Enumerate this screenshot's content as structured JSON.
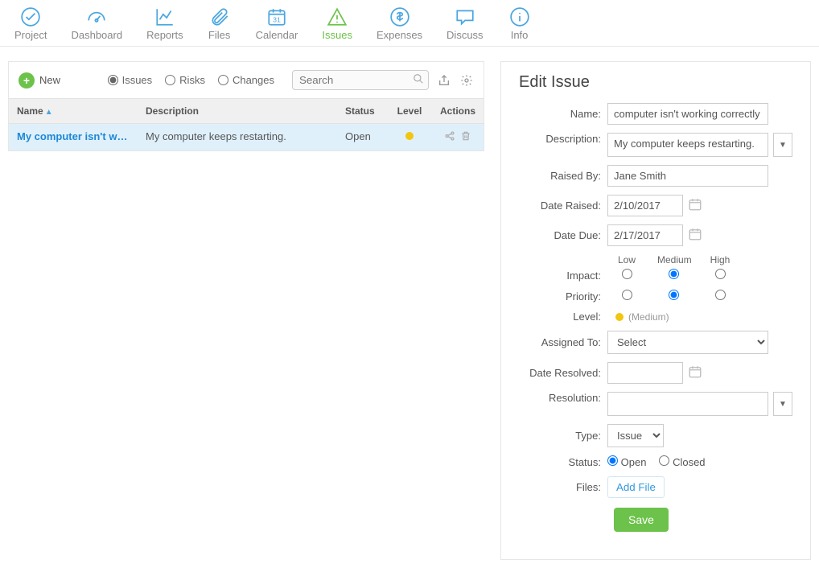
{
  "nav": {
    "items": [
      {
        "label": "Project"
      },
      {
        "label": "Dashboard"
      },
      {
        "label": "Reports"
      },
      {
        "label": "Files"
      },
      {
        "label": "Calendar"
      },
      {
        "label": "Issues"
      },
      {
        "label": "Expenses"
      },
      {
        "label": "Discuss"
      },
      {
        "label": "Info"
      }
    ]
  },
  "toolbar": {
    "new_label": "New",
    "filter_issues": "Issues",
    "filter_risks": "Risks",
    "filter_changes": "Changes",
    "search_placeholder": "Search"
  },
  "grid": {
    "headers": {
      "name": "Name",
      "description": "Description",
      "status": "Status",
      "level": "Level",
      "actions": "Actions"
    },
    "row": {
      "name": "My computer isn't wor...",
      "description": "My computer keeps restarting.",
      "status": "Open",
      "level_color": "#f2c60f"
    }
  },
  "form": {
    "title": "Edit Issue",
    "labels": {
      "name": "Name:",
      "description": "Description:",
      "raised_by": "Raised By:",
      "date_raised": "Date Raised:",
      "date_due": "Date Due:",
      "impact": "Impact:",
      "priority": "Priority:",
      "level": "Level:",
      "assigned_to": "Assigned To:",
      "date_resolved": "Date Resolved:",
      "resolution": "Resolution:",
      "type": "Type:",
      "status": "Status:",
      "files": "Files:"
    },
    "impact_headers": {
      "low": "Low",
      "medium": "Medium",
      "high": "High"
    },
    "values": {
      "name": "computer isn't working correctly",
      "description": "My computer keeps restarting.",
      "raised_by": "Jane Smith",
      "date_raised": "2/10/2017",
      "date_due": "2/17/2017",
      "level_text": "(Medium)",
      "assigned_to": "Select",
      "date_resolved": "",
      "resolution": "",
      "type": "Issue",
      "status_open": "Open",
      "status_closed": "Closed"
    },
    "buttons": {
      "add_file": "Add File",
      "save": "Save"
    }
  }
}
